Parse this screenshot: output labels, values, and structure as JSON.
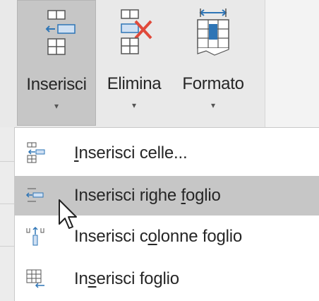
{
  "ribbon": {
    "buttons": [
      {
        "label": "Inserisci",
        "icon": "insert-cells-icon"
      },
      {
        "label": "Elimina",
        "icon": "delete-cells-icon"
      },
      {
        "label": "Formato",
        "icon": "format-icon"
      }
    ],
    "caret": "▾"
  },
  "menu": {
    "items": [
      {
        "pre": "",
        "u": "I",
        "post": "nserisci celle...",
        "icon": "insert-cells-icon"
      },
      {
        "pre": "Inserisci righe ",
        "u": "f",
        "post": "oglio",
        "icon": "insert-rows-icon",
        "highlighted": true
      },
      {
        "pre": "Inserisci c",
        "u": "o",
        "post": "lonne foglio",
        "icon": "insert-columns-icon"
      },
      {
        "pre": "In",
        "u": "s",
        "post": "erisci foglio",
        "icon": "insert-sheet-icon"
      }
    ]
  },
  "colors": {
    "accent_blue": "#2e75b6",
    "delete_red": "#e0493a",
    "highlight": "#c6c6c6"
  }
}
